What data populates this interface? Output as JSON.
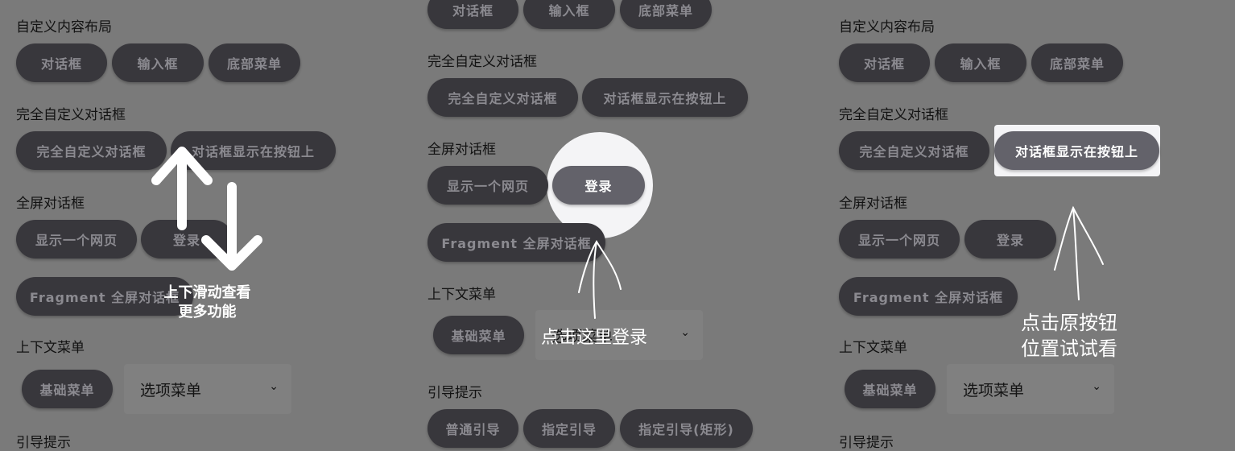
{
  "sections": {
    "custom_layout": "自定义内容布局",
    "full_custom": "完全自定义对话框",
    "fullscreen": "全屏对话框",
    "context_menu": "上下文菜单",
    "guide": "引导提示"
  },
  "buttons": {
    "dialog": "对话框",
    "input": "输入框",
    "bottom_menu": "底部菜单",
    "full_custom_dialog": "完全自定义对话框",
    "dialog_on_button": "对话框显示在按钮上",
    "show_webpage": "显示一个网页",
    "login": "登录",
    "fragment": "Fragment 全屏对话框",
    "basic_menu": "基础菜单",
    "normal_guide": "普通引导",
    "specified_guide": "指定引导",
    "specified_guide_rect": "指定引导(矩形)"
  },
  "select": {
    "value": "选项菜单"
  },
  "annotations": {
    "swipe_line1": "上下滑动查看",
    "swipe_line2": "更多功能",
    "tap_login": "点击这里登录",
    "tap_original_line1": "点击原按钮",
    "tap_original_line2": "位置试试看"
  }
}
